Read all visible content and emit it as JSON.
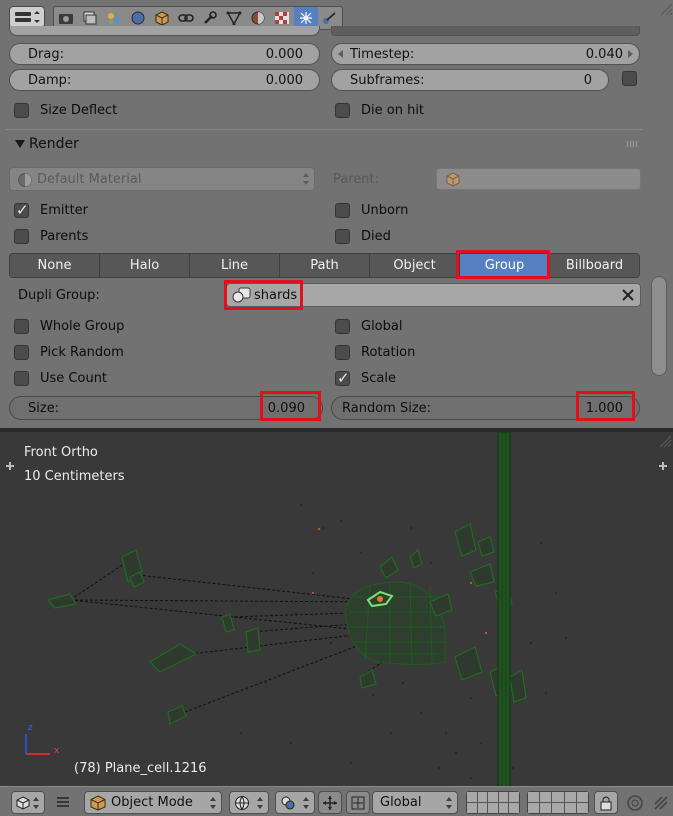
{
  "physics": {
    "drag_label": "Drag:",
    "drag_value": "0.000",
    "damp_label": "Damp:",
    "damp_value": "0.000",
    "timestep_label": "Timestep:",
    "timestep_value": "0.040",
    "subframes_label": "Subframes:",
    "subframes_value": "0",
    "size_deflect_label": "Size Deflect",
    "size_deflect_checked": false,
    "die_on_hit_label": "Die on hit",
    "die_on_hit_checked": false
  },
  "render": {
    "section_title": "Render",
    "material_placeholder": "Default Material",
    "parent_label": "Parent:",
    "emitter_label": "Emitter",
    "emitter_checked": true,
    "unborn_label": "Unborn",
    "unborn_checked": false,
    "parents_label": "Parents",
    "parents_checked": false,
    "died_label": "Died",
    "died_checked": false,
    "render_types": [
      "None",
      "Halo",
      "Line",
      "Path",
      "Object",
      "Group",
      "Billboard"
    ],
    "active_render_type": "Group",
    "dupli_group_label": "Dupli Group:",
    "dupli_group_value": "shards",
    "whole_group_label": "Whole Group",
    "whole_group_checked": false,
    "global_label": "Global",
    "global_checked": false,
    "pick_random_label": "Pick Random",
    "pick_random_checked": false,
    "rotation_label": "Rotation",
    "rotation_checked": false,
    "use_count_label": "Use Count",
    "use_count_checked": false,
    "scale_label": "Scale",
    "scale_checked": true,
    "size_label": "Size:",
    "size_value": "0.090",
    "random_size_label": "Random Size:",
    "random_size_value": "1.000"
  },
  "viewport": {
    "view_name": "Front Ortho",
    "grid_scale": "10 Centimeters",
    "object_info": "(78) Plane_cell.1216",
    "axis_z": "z",
    "axis_x": "x"
  },
  "header": {
    "mode_label": "Object Mode",
    "orientation_label": "Global"
  },
  "colors": {
    "accent": "#5680c2",
    "highlight": "#e3101b",
    "panel": "#727272",
    "viewport_bg": "#393939",
    "wire": "#1f6b1f"
  }
}
